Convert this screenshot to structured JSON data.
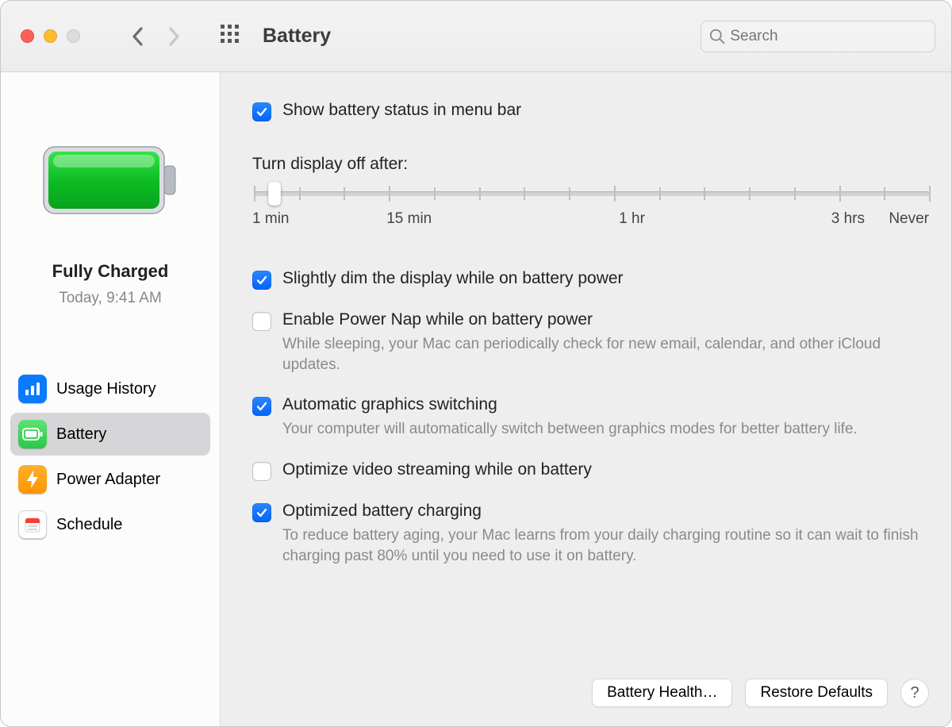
{
  "toolbar": {
    "title": "Battery",
    "search_placeholder": "Search"
  },
  "sidebar": {
    "status_title": "Fully Charged",
    "status_subtitle": "Today, 9:41 AM",
    "items": [
      {
        "id": "usage-history",
        "label": "Usage History",
        "icon": "chart-bar-icon",
        "color": "#0a7aff"
      },
      {
        "id": "battery",
        "label": "Battery",
        "icon": "battery-icon",
        "color": "#34c759",
        "selected": true
      },
      {
        "id": "power-adapter",
        "label": "Power Adapter",
        "icon": "bolt-icon",
        "color": "#ff9f0a"
      },
      {
        "id": "schedule",
        "label": "Schedule",
        "icon": "calendar-icon",
        "color": "#ffffff"
      }
    ]
  },
  "content": {
    "show_status": {
      "label": "Show battery status in menu bar",
      "checked": true
    },
    "slider": {
      "title": "Turn display off after:",
      "labels": {
        "min": "1 min",
        "q1": "15 min",
        "mid": "1 hr",
        "q3": "3 hrs",
        "max": "Never"
      }
    },
    "options": [
      {
        "id": "dim",
        "label": "Slightly dim the display while on battery power",
        "checked": true
      },
      {
        "id": "powernap",
        "label": "Enable Power Nap while on battery power",
        "checked": false,
        "desc": "While sleeping, your Mac can periodically check for new email, calendar, and other iCloud updates."
      },
      {
        "id": "gfx",
        "label": "Automatic graphics switching",
        "checked": true,
        "desc": "Your computer will automatically switch between graphics modes for better battery life."
      },
      {
        "id": "video",
        "label": "Optimize video streaming while on battery",
        "checked": false
      },
      {
        "id": "optchg",
        "label": "Optimized battery charging",
        "checked": true,
        "desc": "To reduce battery aging, your Mac learns from your daily charging routine so it can wait to finish charging past 80% until you need to use it on battery."
      }
    ]
  },
  "footer": {
    "health": "Battery Health…",
    "restore": "Restore Defaults"
  }
}
